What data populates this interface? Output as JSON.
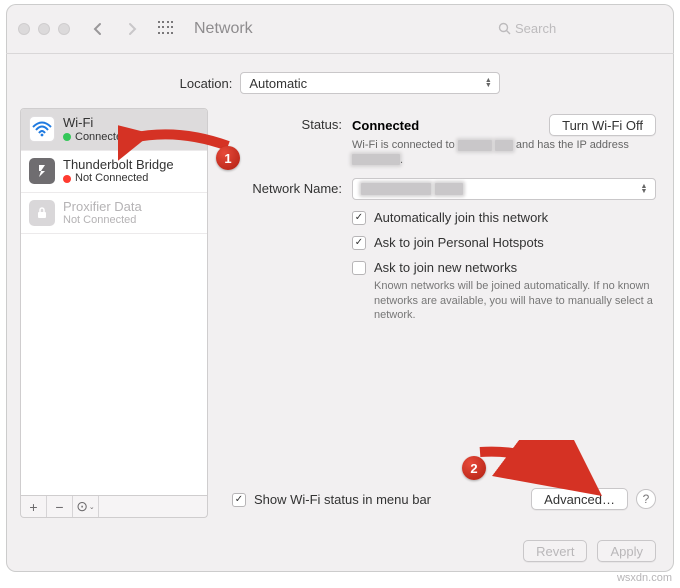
{
  "window": {
    "title": "Network",
    "search_placeholder": "Search"
  },
  "location": {
    "label": "Location:",
    "value": "Automatic"
  },
  "sidebar": {
    "services": [
      {
        "name": "Wi-Fi",
        "status_text": "Connected",
        "status": "green",
        "icon": "wifi",
        "selected": true
      },
      {
        "name": "Thunderbolt Bridge",
        "status_text": "Not Connected",
        "status": "red",
        "icon": "tb",
        "selected": false
      },
      {
        "name": "Proxifier Data",
        "status_text": "Not Connected",
        "status": "grey",
        "icon": "lock",
        "selected": false,
        "disabled": true
      }
    ],
    "footer": {
      "add": "+",
      "remove": "−",
      "actions": "⊙"
    }
  },
  "detail": {
    "status_label": "Status:",
    "status_value": "Connected",
    "turn_off_label": "Turn Wi-Fi Off",
    "status_desc_prefix": "Wi-Fi is connected to ",
    "status_desc_mid": " and has the IP address ",
    "network_name_label": "Network Name:",
    "auto_join_label": "Automatically join this network",
    "ask_hotspot_label": "Ask to join Personal Hotspots",
    "ask_new_label": "Ask to join new networks",
    "ask_new_hint": "Known networks will be joined automatically. If no known networks are available, you will have to manually select a network.",
    "show_status_label": "Show Wi-Fi status in menu bar",
    "advanced_label": "Advanced…",
    "help_label": "?"
  },
  "footer": {
    "revert": "Revert",
    "apply": "Apply"
  },
  "annotations": {
    "marker1": "1",
    "marker2": "2"
  },
  "watermark": "wsxdn.com"
}
